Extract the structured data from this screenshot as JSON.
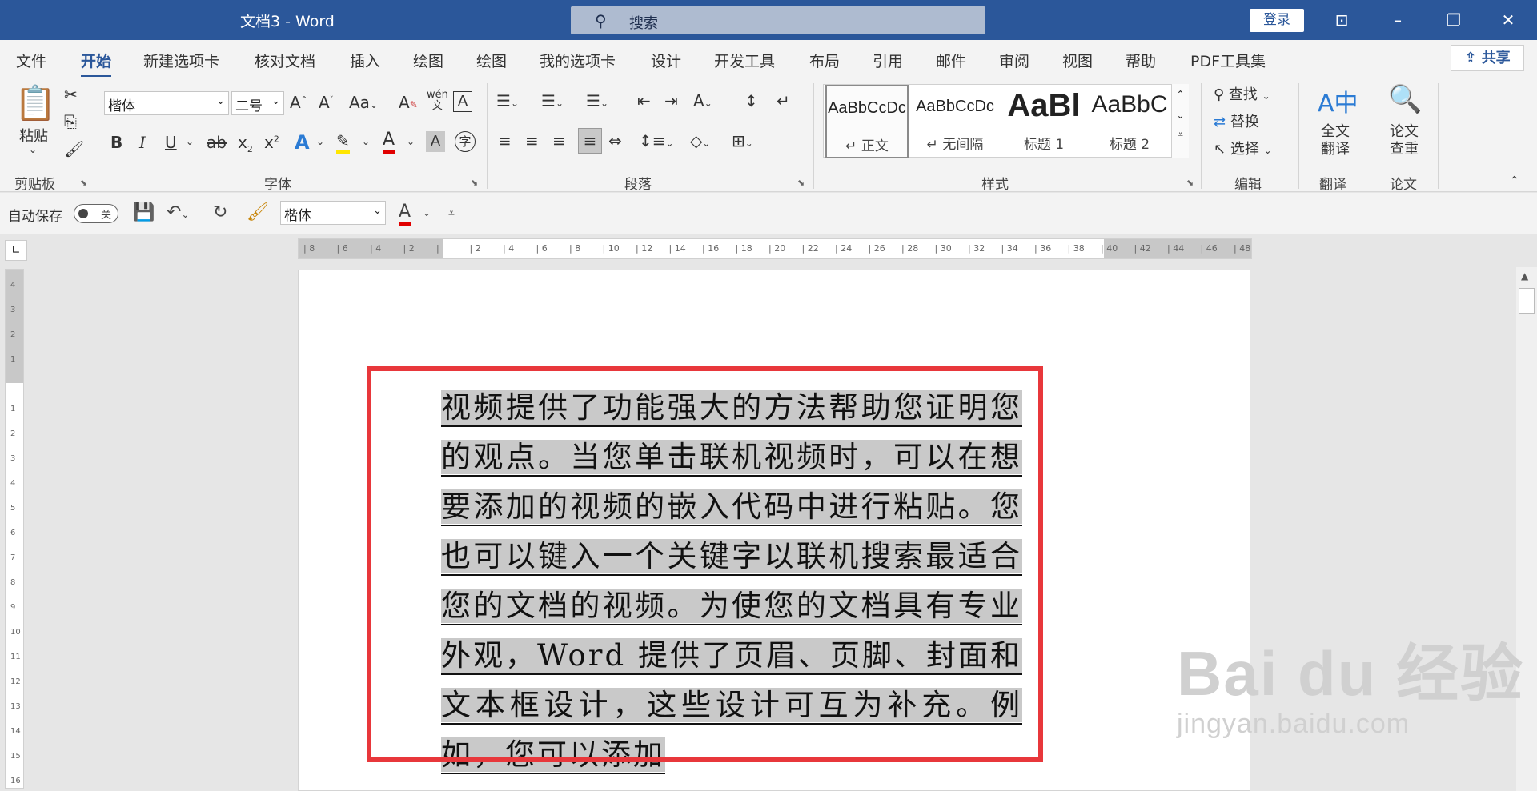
{
  "titlebar": {
    "title": "文档3  -  Word",
    "search_placeholder": "搜索",
    "login": "登录"
  },
  "tabs": [
    "文件",
    "开始",
    "新建选项卡",
    "核对文档",
    "插入",
    "绘图",
    "绘图",
    "我的选项卡",
    "设计",
    "开发工具",
    "布局",
    "引用",
    "邮件",
    "审阅",
    "视图",
    "帮助",
    "PDF工具集"
  ],
  "share": "共享",
  "ribbon": {
    "paste": "粘贴",
    "clipboard_label": "剪贴板",
    "font_name": "楷体",
    "font_size": "二号",
    "font_label": "字体",
    "paragraph_label": "段落",
    "styles_label": "样式",
    "styles": [
      {
        "preview": "AaBbCcDc",
        "name": "正文"
      },
      {
        "preview": "AaBbCcDc",
        "name": "无间隔"
      },
      {
        "preview": "AaBl",
        "name": "标题 1"
      },
      {
        "preview": "AaBbC",
        "name": "标题 2"
      }
    ],
    "find": "查找",
    "replace": "替换",
    "select": "选择",
    "editing_label": "编辑",
    "translate_btn_l1": "全文",
    "translate_btn_l2": "翻译",
    "translate_label": "翻译",
    "paper_btn_l1": "论文",
    "paper_btn_l2": "查重",
    "paper_label": "论文",
    "wen_label": "wén"
  },
  "qat": {
    "autosave_label": "自动保存",
    "autosave_state": "关",
    "font_name": "楷体"
  },
  "document": {
    "text": "视频提供了功能强大的方法帮助您证明您的观点。当您单击联机视频时，可以在想要添加的视频的嵌入代码中进行粘贴。您也可以键入一个关键字以联机搜索最适合您的文档的视频。为使您的文档具有专业外观，Word 提供了页眉、页脚、封面和文本框设计，这些设计可互为补充。例如，您可以添加"
  },
  "ruler_h": [
    "8",
    "6",
    "4",
    "2",
    "",
    "2",
    "4",
    "6",
    "8",
    "10",
    "12",
    "14",
    "16",
    "18",
    "20",
    "22",
    "24",
    "26",
    "28",
    "30",
    "32",
    "34",
    "36",
    "38",
    "40",
    "42",
    "44",
    "46",
    "48"
  ],
  "ruler_v": [
    "4",
    "3",
    "2",
    "1",
    "",
    "1",
    "2",
    "3",
    "4",
    "5",
    "6",
    "7",
    "8",
    "9",
    "10",
    "11",
    "12",
    "13",
    "14",
    "15",
    "16"
  ],
  "watermark": {
    "brand": "Bai du 经验",
    "url": "jingyan.baidu.com"
  },
  "colors": {
    "accent": "#2b579a",
    "highlight_box": "#e8373b",
    "selection": "#c9c9c9"
  }
}
